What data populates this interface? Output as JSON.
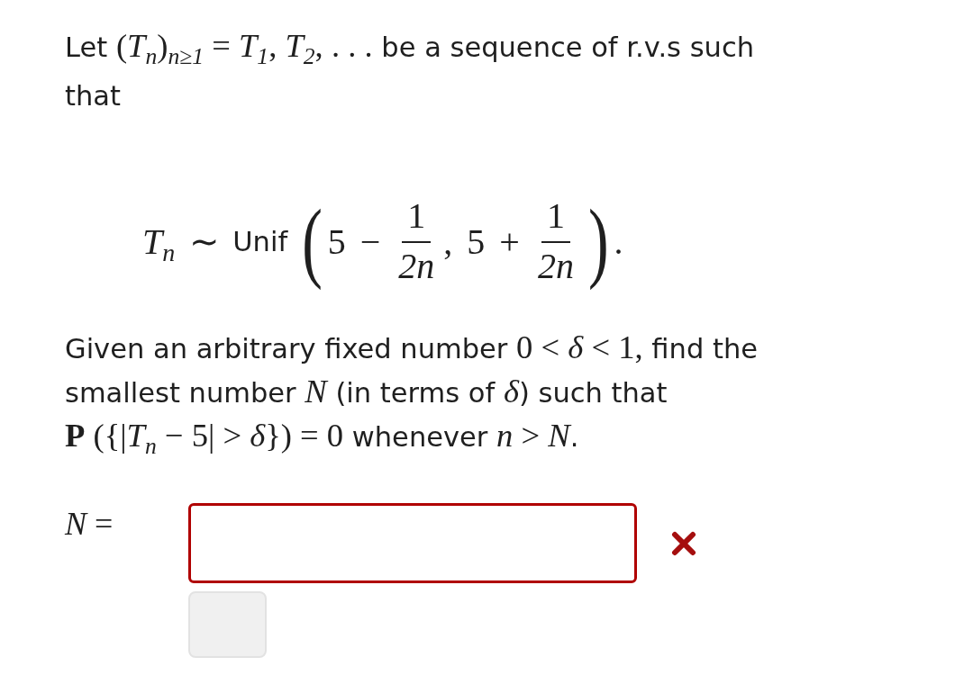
{
  "intro": [
    {
      "kind": "text",
      "text": "Let "
    },
    {
      "kind": "math",
      "text": "(*T*$_{n}$)$_{n≥1}$ = *T*$_{1}$, *T*$_{2}$, . . ."
    },
    {
      "kind": "text",
      "text": " be a sequence of r.v.s such that"
    }
  ],
  "formula": [
    {
      "kind": "math",
      "text": "*T*$_{n}$ ∼"
    },
    {
      "kind": "text",
      "text": "Unif"
    },
    {
      "kind": "open",
      "text": "("
    },
    {
      "kind": "math",
      "text": "5 −"
    },
    {
      "kind": "fraction",
      "numerator": "1",
      "denominator": "2n"
    },
    {
      "kind": "math",
      "text": ", 5 +"
    },
    {
      "kind": "fraction",
      "numerator": "1",
      "denominator": "2n"
    },
    {
      "kind": "close",
      "text": ")"
    },
    {
      "kind": "math",
      "text": "."
    }
  ],
  "question": [
    {
      "kind": "text",
      "text": "Given an arbitrary fixed number "
    },
    {
      "kind": "math",
      "text": "0 < *δ* < 1,"
    },
    {
      "kind": "text",
      "text": " find the smallest number "
    },
    {
      "kind": "math",
      "text": "*N*"
    },
    {
      "kind": "text",
      "text": " (in terms of "
    },
    {
      "kind": "math",
      "text": "*δ*"
    },
    {
      "kind": "text",
      "text": ") such that "
    },
    {
      "kind": "math",
      "text": "**P** ({|*T*$_{n}$ − 5| > *δ*}) = 0"
    },
    {
      "kind": "text",
      "text": " whenever "
    },
    {
      "kind": "math",
      "text": "*n* > *N*"
    },
    {
      "kind": "text",
      "text": "."
    }
  ],
  "answer": {
    "label": "*N* =",
    "correct": false
  }
}
